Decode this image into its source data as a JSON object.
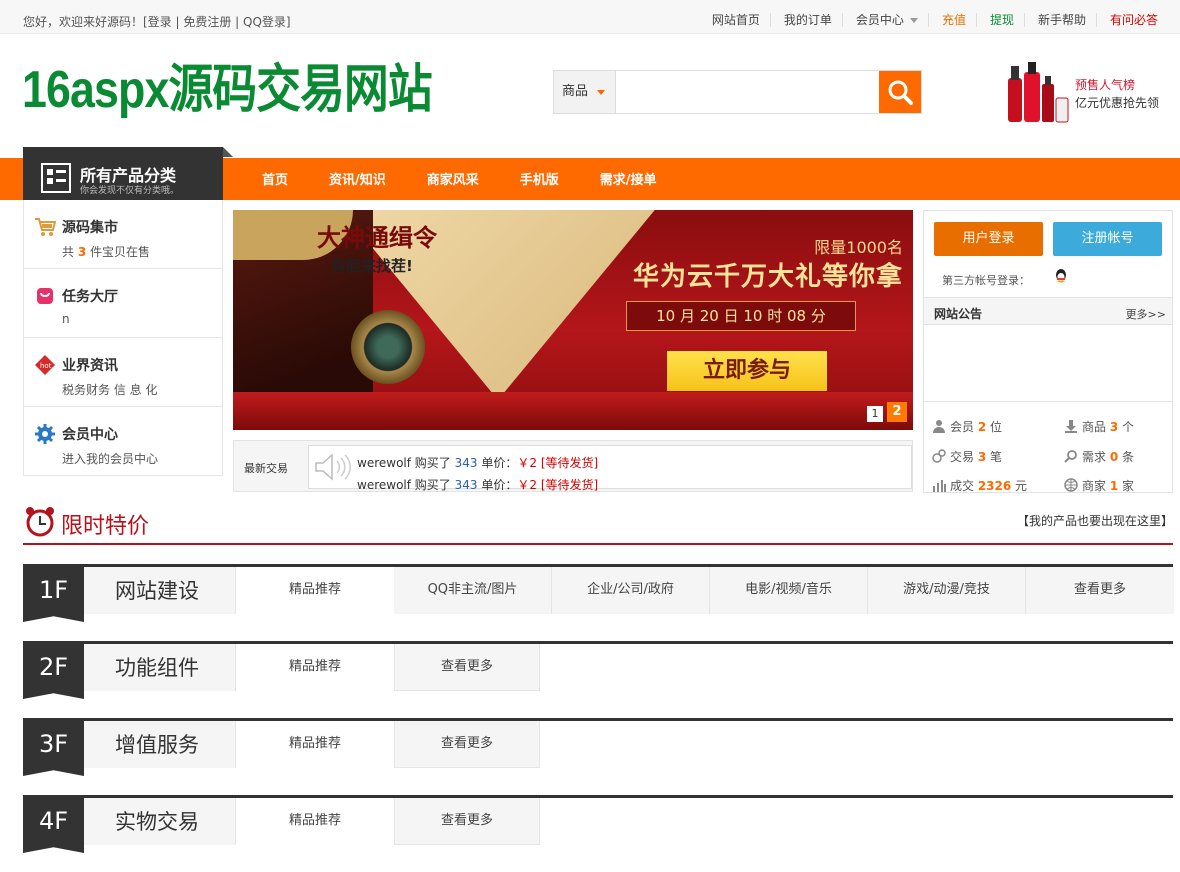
{
  "topbar": {
    "welcome": "您好，欢迎来好源码！[登录 | 免费注册 | QQ登录]",
    "links": [
      {
        "label": "网站首页",
        "color": "#444444"
      },
      {
        "label": "我的订单",
        "color": "#444444"
      },
      {
        "label": "会员中心",
        "color": "#444444"
      },
      {
        "label": "充值",
        "color": "#e86e00"
      },
      {
        "label": "提现",
        "color": "#0a8a33"
      },
      {
        "label": "新手帮助",
        "color": "#444444"
      },
      {
        "label": "有问必答",
        "color": "#d40000"
      }
    ]
  },
  "header": {
    "logo": "16aspx源码交易网站",
    "search": {
      "category": "商品",
      "placeholder": ""
    },
    "ad": {
      "line1": "预售人气榜",
      "line2": "亿元优惠抢先领"
    }
  },
  "nav": {
    "all_categories": "所有产品分类",
    "all_categories_sub": "你会发现不仅有分类哦。",
    "items": [
      "首页",
      "资讯/知识",
      "商家风采",
      "手机版",
      "需求/接单"
    ]
  },
  "left_menu": [
    {
      "title": "源码集市",
      "sub_prefix": "共 ",
      "sub_count": "3",
      "sub_suffix": " 件宝贝在售",
      "icon": "cart-icon"
    },
    {
      "title": "任务大厅",
      "sub_prefix": "n",
      "sub_count": "",
      "sub_suffix": "",
      "icon": "task-bag-icon"
    },
    {
      "title": "业界资讯",
      "sub_prefix": "税务财务 信 息 化",
      "sub_count": "",
      "sub_suffix": "",
      "icon": "news-tag-icon"
    },
    {
      "title": "会员中心",
      "sub_prefix": "进入我的会员中心",
      "sub_count": "",
      "sub_suffix": "",
      "icon": "gear-icon"
    }
  ],
  "banner": {
    "headline": "大神通缉令",
    "subline": "有胆来找茬!",
    "limit": "限量1000名",
    "big": "华为云千万大礼等你拿",
    "date": "10 月 20  日 10 时 08  分",
    "cta": "立即参与",
    "pages": [
      "1",
      "2"
    ]
  },
  "trades": {
    "label": "最新交易",
    "rows": [
      {
        "user": "werewolf",
        "action": " 购买了 ",
        "qty": "343",
        "price_label": " 单价：",
        "price": "￥2",
        "status": "[等待发货]"
      },
      {
        "user": "werewolf",
        "action": " 购买了 ",
        "qty": "343",
        "price_label": " 单价：",
        "price": "￥2",
        "status": "[等待发货]"
      }
    ]
  },
  "right_panel": {
    "login": "用户登录",
    "register": "注册帐号",
    "third_party": "第三方帐号登录：",
    "notice_title": "网站公告",
    "more": "更多>>",
    "stats": [
      {
        "pre": "会员 ",
        "val": "2",
        "post": " 位",
        "icon": "member-icon"
      },
      {
        "pre": "商品 ",
        "val": "3",
        "post": " 个",
        "icon": "download-icon"
      },
      {
        "pre": "交易 ",
        "val": "3",
        "post": " 笔",
        "icon": "trade-icon"
      },
      {
        "pre": "需求 ",
        "val": "0",
        "post": " 条",
        "icon": "search-icon"
      },
      {
        "pre": "成交 ",
        "val": "2326",
        "post": " 元",
        "icon": "chart-icon"
      },
      {
        "pre": "商家 ",
        "val": "1",
        "post": " 家",
        "icon": "shop-icon"
      }
    ]
  },
  "flash": {
    "title": "限时特价",
    "link": "【我的产品也要出现在这里】"
  },
  "floors": [
    {
      "num": "1F",
      "name": "网站建设",
      "tabs": [
        "精品推荐",
        "QQ非主流/图片",
        "企业/公司/政府",
        "电影/视频/音乐",
        "游戏/动漫/竞技",
        "查看更多"
      ]
    },
    {
      "num": "2F",
      "name": "功能组件",
      "tabs": [
        "精品推荐",
        "查看更多"
      ]
    },
    {
      "num": "3F",
      "name": "增值服务",
      "tabs": [
        "精品推荐",
        "查看更多"
      ]
    },
    {
      "num": "4F",
      "name": "实物交易",
      "tabs": [
        "精品推荐",
        "查看更多"
      ]
    }
  ]
}
